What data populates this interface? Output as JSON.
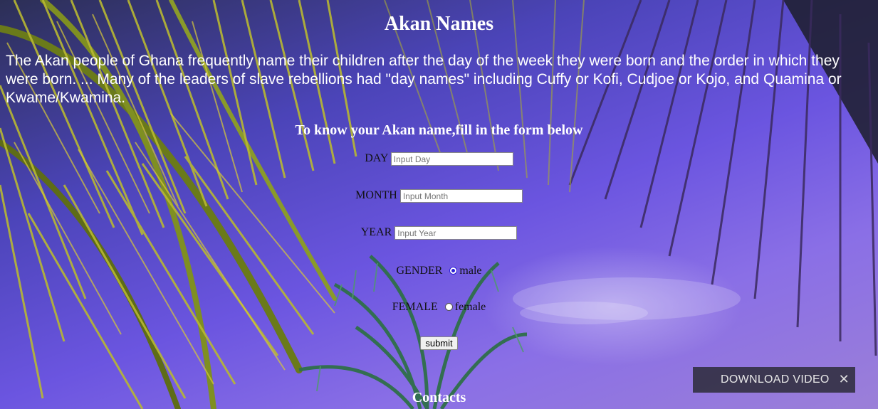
{
  "page": {
    "title": "Akan Names",
    "intro": "The Akan people of Ghana frequently name their children after the day of the week they were born and the order in which they were born. ... Many of the leaders of slave rebellions had \"day names\" including Cuffy or Kofi, Cudjoe or Kojo, and Quamina or Kwame/Kwamina."
  },
  "form": {
    "heading": "To know your Akan name,fill in the form below",
    "day_label": "DAY",
    "day_placeholder": "Input Day",
    "month_label": "MONTH",
    "month_placeholder": "Input Month",
    "year_label": "YEAR",
    "year_placeholder": "Input Year",
    "gender_label": "GENDER",
    "male_label": "male",
    "female_row_label": "FEMALE",
    "female_label": "female",
    "selected_gender": "male",
    "submit_label": "submit"
  },
  "footer": {
    "contacts_heading": "Contacts"
  },
  "overlay": {
    "download_label": "DOWNLOAD VIDEO",
    "close_icon": "close-icon"
  },
  "colors": {
    "sky": "#6b55e0",
    "radio_accent": "#2a1cd6"
  }
}
